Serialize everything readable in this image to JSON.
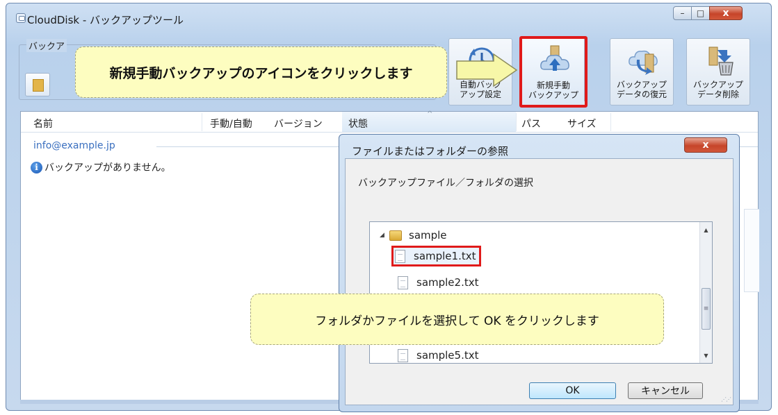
{
  "window": {
    "title": "CloudDisk - バックアップツール",
    "controls": {
      "minimize": "–",
      "maximize": "□",
      "close": "x"
    }
  },
  "toolbar": {
    "group_label": "バックア",
    "buttons": [
      {
        "id": "auto",
        "label_line1": "自動バック",
        "label_line2": "アップ設定",
        "icon": "clock-sync-icon"
      },
      {
        "id": "new-manual",
        "label_line1": "新規手動",
        "label_line2": "バックアップ",
        "icon": "cloud-upload-icon",
        "highlighted": true
      },
      {
        "id": "restore",
        "label_line1": "バックアップ",
        "label_line2": "データの復元",
        "icon": "cloud-restore-icon"
      },
      {
        "id": "delete",
        "label_line1": "バックアップ",
        "label_line2": "データ削除",
        "icon": "trash-icon"
      }
    ]
  },
  "list": {
    "columns": [
      "名前",
      "手動/自動",
      "バージョン",
      "状態",
      "パス",
      "サイズ"
    ],
    "sorted_column": "状態",
    "account": "info@example.jp",
    "empty_message": "バックアップがありません。"
  },
  "dialog": {
    "title": "ファイルまたはフォルダーの参照",
    "close": "x",
    "description": "バックアップファイル／フォルダの選択",
    "tree": {
      "folder": "sample",
      "items": [
        "sample1.txt",
        "sample2.txt",
        "sample5.txt"
      ],
      "selected": "sample1.txt"
    },
    "ok_label": "OK",
    "cancel_label": "キャンセル"
  },
  "callouts": {
    "top": "新規手動バックアップのアイコンをクリックします",
    "bottom": "フォルダかファイルを選択して OK をクリックします"
  },
  "colors": {
    "highlight": "#e01a1a",
    "callout_bg": "#fdfdc0",
    "arrow_fill": "#f7f7a8",
    "account_text": "#3a6fbf"
  }
}
